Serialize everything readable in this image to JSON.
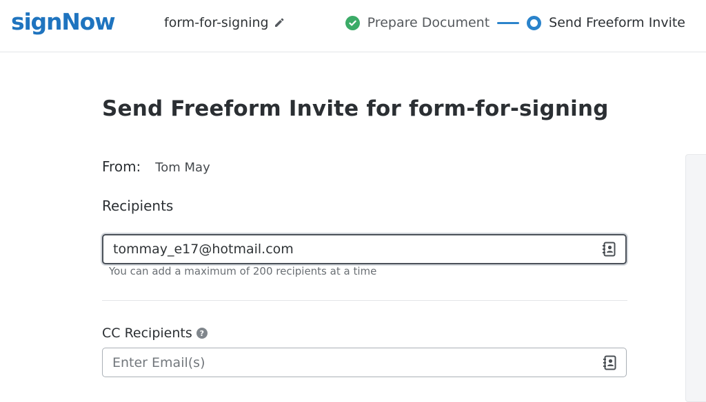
{
  "header": {
    "logo_text": "signNow",
    "document_name": "form-for-signing",
    "steps": [
      {
        "label": "Prepare Document",
        "status": "completed"
      },
      {
        "label": "Send Freeform Invite",
        "status": "active"
      }
    ]
  },
  "main": {
    "title": "Send Freeform Invite for form-for-signing",
    "from_label": "From:",
    "from_value": "Tom May",
    "recipients_label": "Recipients",
    "recipients_value": "tommay_e17@hotmail.com",
    "recipients_hint": "You can add a maximum of 200 recipients at a time",
    "cc_label": "CC Recipients",
    "cc_placeholder": "Enter Email(s)"
  },
  "icons": {
    "edit": "pencil-icon",
    "completed_step": "check-circle-icon",
    "active_step": "radio-active-icon",
    "contacts": "address-book-icon",
    "help": "question-circle-icon"
  },
  "colors": {
    "brand": "#1f74bf",
    "success": "#3bab67",
    "accent": "#2a83cb"
  }
}
